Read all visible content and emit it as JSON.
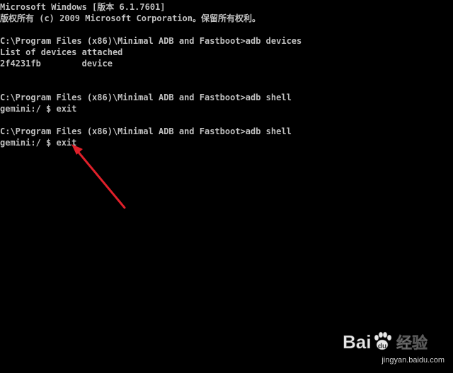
{
  "console": {
    "lines": [
      "Microsoft Windows [版本 6.1.7601]",
      "版权所有 (c) 2009 Microsoft Corporation。保留所有权利。",
      "",
      "C:\\Program Files (x86)\\Minimal ADB and Fastboot>adb devices",
      "List of devices attached",
      "2f4231fb        device",
      "",
      "",
      "C:\\Program Files (x86)\\Minimal ADB and Fastboot>adb shell",
      "gemini:/ $ exit",
      "",
      "C:\\Program Files (x86)\\Minimal ADB and Fastboot>adb shell",
      "gemini:/ $ exit"
    ]
  },
  "annotation": {
    "arrow_color": "#e0202a",
    "icon": "arrow-pointer-icon"
  },
  "watermark": {
    "logo_text": "Bai 经验",
    "url": "jingyan.baidu.com"
  },
  "colors": {
    "background": "#000000",
    "text": "#c0c0c0"
  }
}
